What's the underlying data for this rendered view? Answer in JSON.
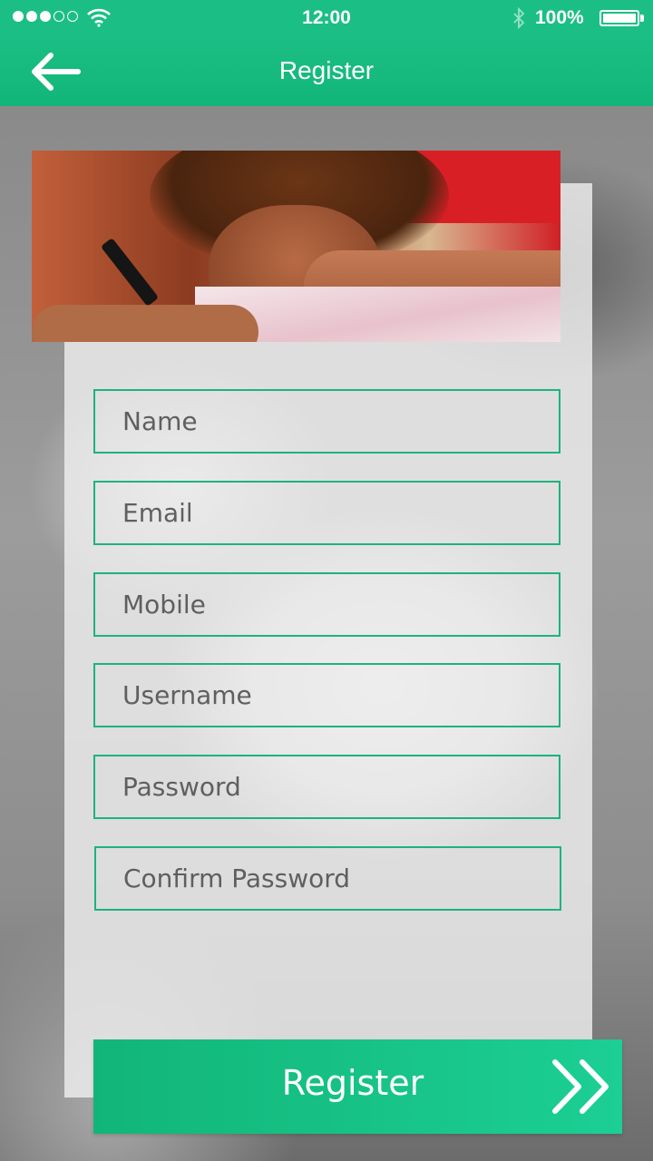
{
  "status_bar": {
    "time": "12:00",
    "battery_percent": "100%",
    "signal_filled_dots": 3,
    "signal_total_dots": 5
  },
  "header": {
    "title": "Register",
    "back_icon": "arrow-left-icon"
  },
  "form": {
    "fields": [
      {
        "placeholder": "Name",
        "value": ""
      },
      {
        "placeholder": "Email",
        "value": ""
      },
      {
        "placeholder": "Mobile",
        "value": ""
      },
      {
        "placeholder": "Username",
        "value": ""
      },
      {
        "placeholder": "Password",
        "value": ""
      },
      {
        "placeholder": "Confirm Password",
        "value": ""
      }
    ]
  },
  "actions": {
    "register_label": "Register",
    "register_icon": "double-chevron-right-icon"
  },
  "colors": {
    "accent": "#1bbf85",
    "field_border": "#1bb47c",
    "card_background": "#eeeeee"
  }
}
